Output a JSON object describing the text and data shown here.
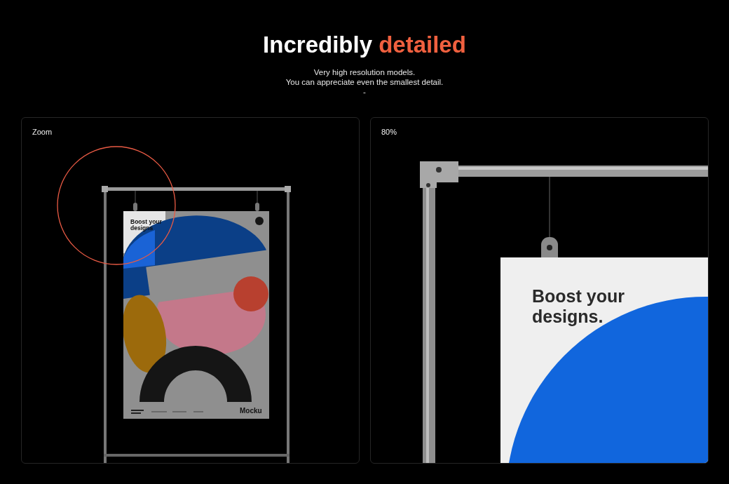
{
  "header": {
    "title": "Incredibly",
    "title_accent": "detailed",
    "subtitle_lines": [
      "Very high resolution models.",
      "You can appreciate even the smallest detail.",
      "-"
    ]
  },
  "panels": [
    {
      "kind": "overview",
      "label": "Zoom",
      "poster_heading": [
        "Boost your",
        "designs"
      ],
      "brand": "Mocku"
    },
    {
      "kind": "closeup",
      "label": "80%",
      "poster_heading": [
        "Boost your",
        "designs."
      ]
    }
  ]
}
